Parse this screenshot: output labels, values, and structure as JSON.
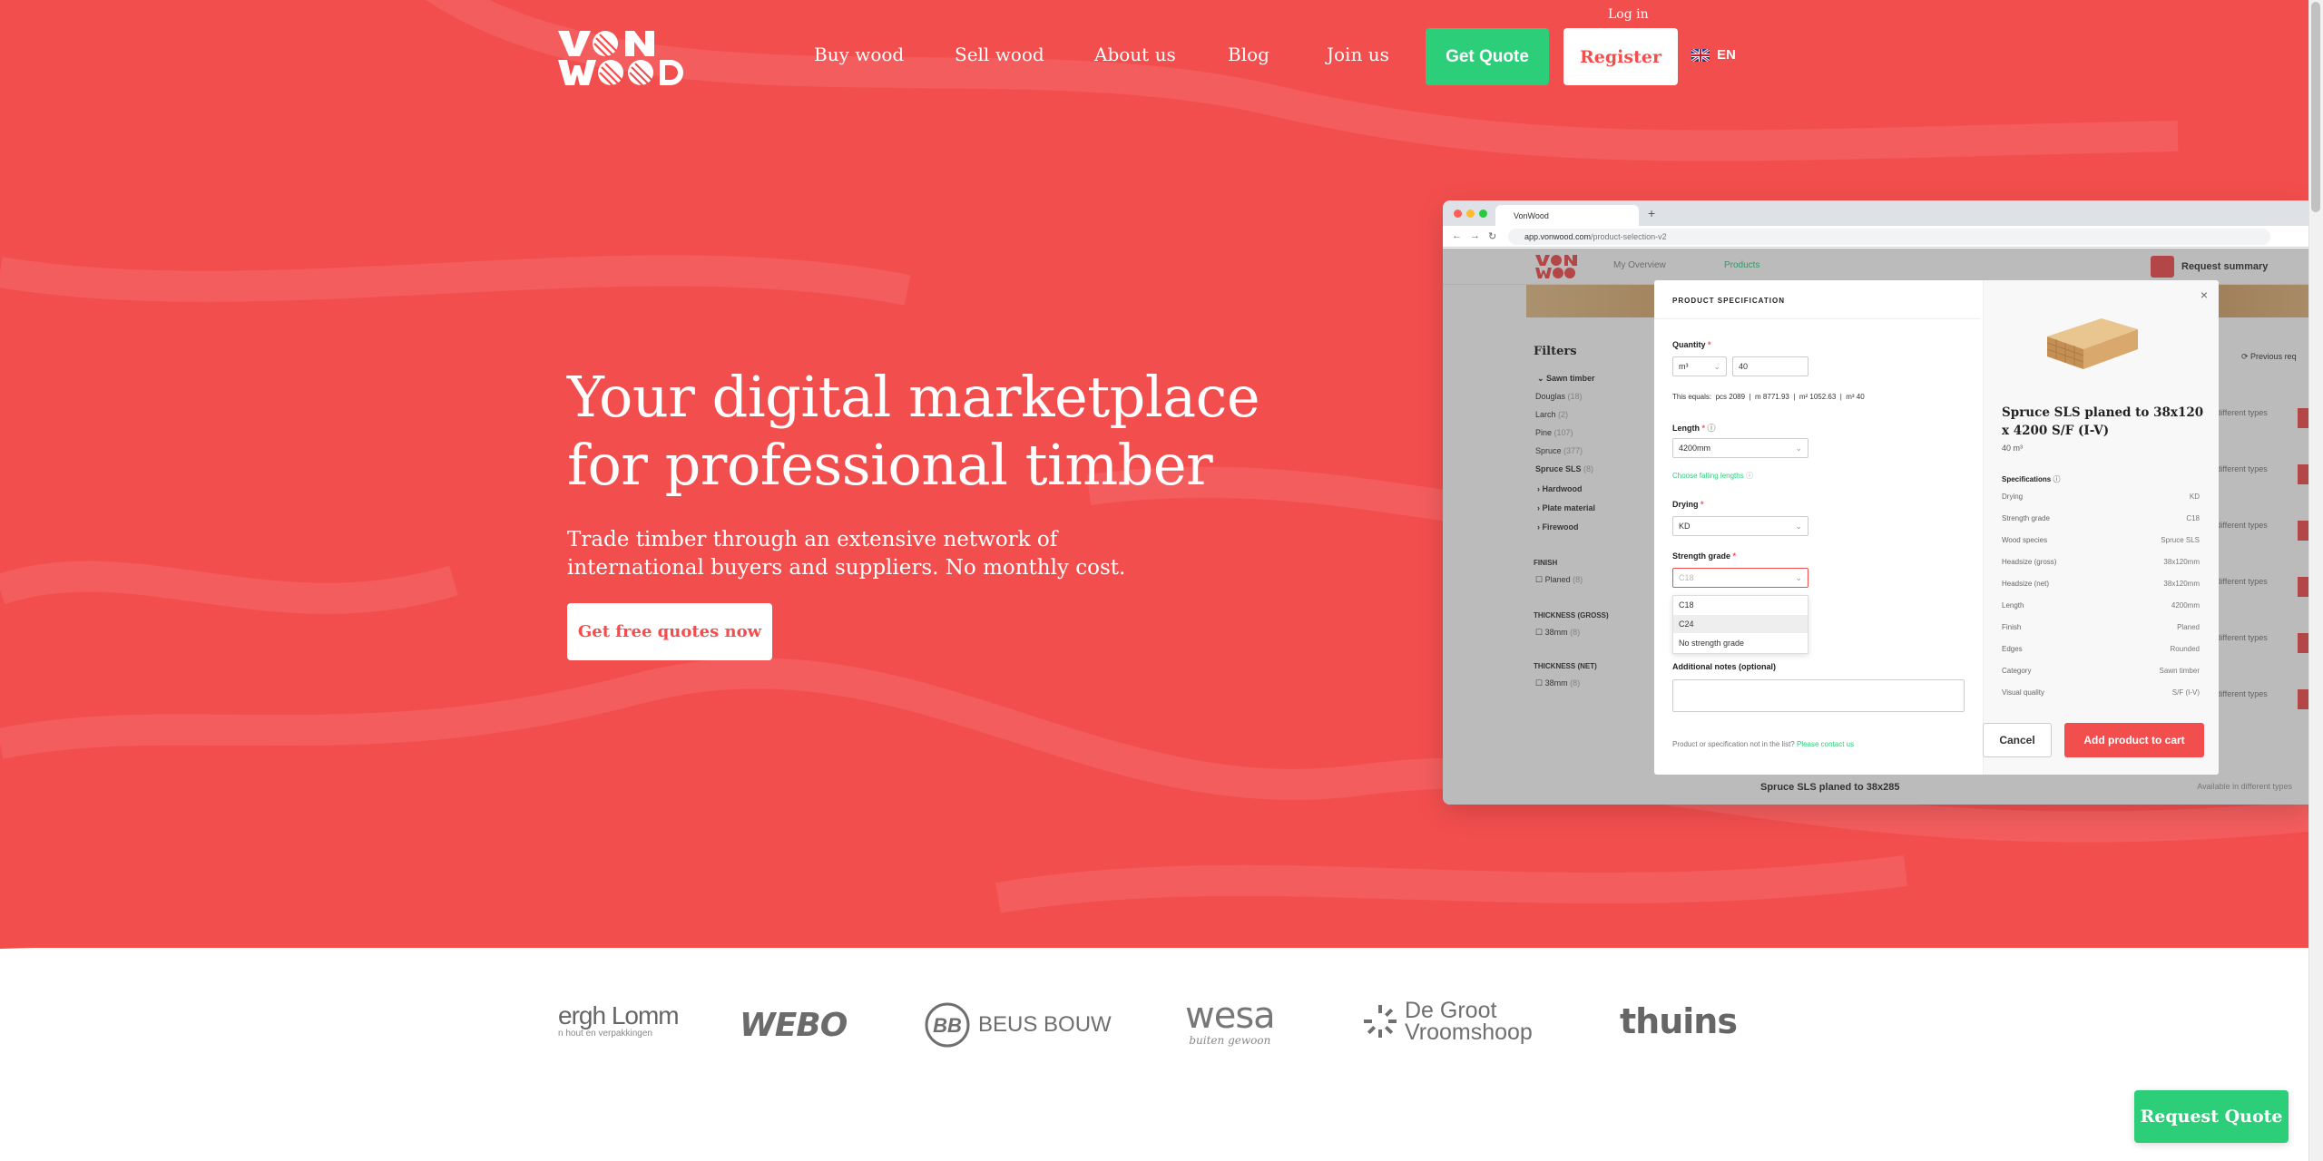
{
  "header": {
    "login": "Log in",
    "nav": [
      "Buy wood",
      "Sell wood",
      "About us",
      "Blog",
      "Join us"
    ],
    "get_quote": "Get Quote",
    "register": "Register",
    "language": "EN",
    "logo_text": "VONWOOD"
  },
  "hero": {
    "headline_line1": "Your digital marketplace",
    "headline_line2": "for professional timber",
    "subline_line1": "Trade timber through an extensive network of",
    "subline_line2": "international buyers and suppliers. No monthly cost.",
    "cta": "Get free quotes now"
  },
  "app_screenshot": {
    "tab_title": "VonWood",
    "url_host": "app.vonwood.com",
    "url_path": "/product-selection-v2",
    "menu": [
      "My Overview",
      "Products"
    ],
    "request_summary": "Request summary",
    "previous_requests": "Previous req",
    "filters": {
      "title": "Filters",
      "category": "Sawn timber",
      "species": [
        {
          "label": "Douglas",
          "count": "(18)"
        },
        {
          "label": "Larch",
          "count": "(2)"
        },
        {
          "label": "Pine",
          "count": "(107)"
        },
        {
          "label": "Spruce",
          "count": "(377)"
        },
        {
          "label": "Spruce SLS",
          "count": "(8)"
        }
      ],
      "groups": [
        "Hardwood",
        "Plate material",
        "Firewood"
      ],
      "finish_head": "FINISH",
      "finish_opt": "Planed",
      "finish_count": "(8)",
      "thick_gross_head": "THICKNESS (GROSS)",
      "thick_gross_opt": "38mm",
      "thick_gross_count": "(8)",
      "thick_net_head": "THICKNESS (NET)",
      "thick_net_opt": "38mm",
      "thick_net_count": "(8)"
    },
    "available_label": "Available in different types",
    "bottom_product": "Spruce SLS planed to 38x285",
    "modal": {
      "title": "PRODUCT SPECIFICATION",
      "quantity_label": "Quantity",
      "quantity_unit": "m³",
      "quantity_value": "40",
      "equals_label": "This equals:",
      "equals_pcs": "pcs  2089",
      "equals_m": "m  8771.93",
      "equals_m2": "m²  1052.63",
      "equals_m3": "m³  40",
      "length_label": "Length",
      "length_value": "4200mm",
      "falling_lengths": "Choose falling lengths",
      "drying_label": "Drying",
      "drying_value": "KD",
      "strength_label": "Strength grade",
      "strength_placeholder": "C18",
      "strength_options": [
        "C18",
        "C24",
        "No strength grade"
      ],
      "notes_label": "Additional notes (optional)",
      "footer_text": "Product or specification not in the list?",
      "footer_link": "Please contact us",
      "cancel": "Cancel",
      "add": "Add product to cart",
      "product_title": "Spruce SLS planed to 38x120 x 4200 S/F (I-V)",
      "product_qty": "40 m³",
      "spec_head": "Specifications",
      "specs": [
        {
          "k": "Drying",
          "v": "KD"
        },
        {
          "k": "Strength grade",
          "v": "C18"
        },
        {
          "k": "Wood species",
          "v": "Spruce SLS"
        },
        {
          "k": "Headsize (gross)",
          "v": "38x120mm"
        },
        {
          "k": "Headsize (net)",
          "v": "38x120mm"
        },
        {
          "k": "Length",
          "v": "4200mm"
        },
        {
          "k": "Finish",
          "v": "Planed"
        },
        {
          "k": "Edges",
          "v": "Rounded"
        },
        {
          "k": "Category",
          "v": "Sawn timber"
        },
        {
          "k": "Visual quality",
          "v": "S/F (I-V)"
        }
      ]
    }
  },
  "partners": [
    "ergh Lomm",
    "WEBO",
    "BEUS BOUW",
    "wesa",
    "De Groot Vroomshoop",
    "thuins"
  ],
  "partner_taglines": {
    "lomm": "n hout en verpakkingen",
    "wesa": "buiten gewoon"
  },
  "request_quote": "Request Quote",
  "colors": {
    "brand_red": "#f34e4e",
    "brand_green": "#2dce7a",
    "white": "#ffffff"
  }
}
